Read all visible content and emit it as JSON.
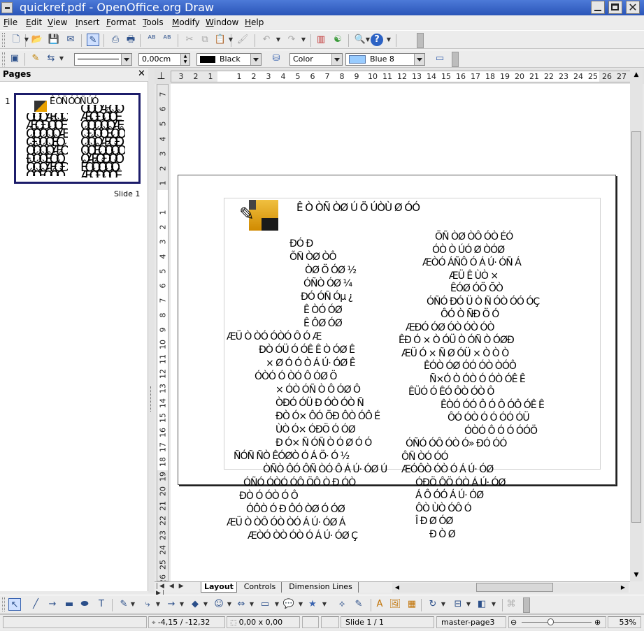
{
  "window": {
    "title": "quickref.pdf - OpenOffice.org Draw"
  },
  "menu": [
    {
      "label": "File",
      "mnemonic": "F",
      "rest": "ile"
    },
    {
      "label": "Edit",
      "mnemonic": "E",
      "rest": "dit"
    },
    {
      "label": "View",
      "mnemonic": "V",
      "rest": "iew"
    },
    {
      "label": "Insert",
      "mnemonic": "I",
      "rest": "nsert"
    },
    {
      "label": "Format",
      "mnemonic": "F",
      "rest": "ormat"
    },
    {
      "label": "Tools",
      "mnemonic": "T",
      "rest": "ools"
    },
    {
      "label": "Modify",
      "mnemonic": "M",
      "rest": "odify"
    },
    {
      "label": "Window",
      "mnemonic": "W",
      "rest": "indow"
    },
    {
      "label": "Help",
      "mnemonic": "H",
      "rest": "elp"
    }
  ],
  "line_toolbar": {
    "line_width": "0,00cm",
    "line_color": "Black",
    "area_style": "Color",
    "area_color": "Blue 8",
    "line_color_hex": "#000000",
    "area_color_hex": "#99ccff"
  },
  "pages_pane": {
    "title": "Pages",
    "slide_number": "1",
    "slide_label": "Slide 1"
  },
  "rulers": {
    "h": [
      "3",
      "2",
      "1",
      "1",
      "2",
      "3",
      "4",
      "5",
      "6",
      "7",
      "8",
      "9",
      "10",
      "11",
      "12",
      "13",
      "14",
      "15",
      "16",
      "17",
      "18",
      "19",
      "20",
      "21",
      "22",
      "23",
      "24",
      "25",
      "26",
      "27"
    ],
    "v": [
      "7",
      "6",
      "5",
      "4",
      "3",
      "2",
      "1",
      "1",
      "2",
      "3",
      "4",
      "5",
      "6",
      "7",
      "8",
      "9",
      "10",
      "11",
      "12",
      "13",
      "14",
      "15",
      "16",
      "17",
      "18",
      "19",
      "20",
      "21",
      "22",
      "23",
      "24",
      "25",
      "26"
    ]
  },
  "page_text": {
    "header": "Ê        Ò   ÒÑ   ÒØ Ú Ö           ÚÒÙ Ø ÓÓ",
    "left": [
      "ÐÓ Ð",
      "ÕÑ ÒØ ÒÔ",
      "ÒØ Ö      ÓØ ½",
      "ÓÑÒ      ÓØ ¼",
      "ÐÓ ÓÑ      Óµ ¿",
      "Ê ÒÓ      ÓØ",
      "Ê ÔØ      ÓØ",
      "ÆÜ Ò ÒÓ ÓÒÓ Ô      Ó Æ",
      "ÐÒ ÓÜ  Ó ÓÊ Ê Ò      ÓØ Ê",
      "× Ø Ó  Ó Ò Á Ú·      ÓØ Ê",
      "ÓÒÓ Ó ÒÓ Ô      ÓØ Ö",
      "× ÓÒ ÓÑ Ò Ô      ÓØ Ô",
      "ÒÐÓ ÓÜ Ð ÓÒ      ÓÒ Ñ",
      "ÐÒ Ó× ÔÓ  ÖÐ ÔÒ      ÓÔ É",
      "ÙÒ Ó× ÓÐÖ Ó       ÓØ",
      "Ð Ó× Ñ ÓÑ Ò Ó Ø   Ó Ó",
      "ÑÓÑ ÑÒ ÊÓØÒ   Ó Á Ö·   Ó ½",
      "ÒÑÒ ÔÓ ÔÑ ÒÓ Ô  Á Ú·   ÓØ Ú",
      "ÓÑÓ  ÓÒÓ      ÓÔ ÖÔ      Ò Ð ÓÒ",
      "ÐÒ Ó   ÓÒ  Ó Ô",
      "ÓÔÒ Ó Ð ÔÓ  ÒØ   Ó ÓØ",
      "ÆÜ Ò ÒÔ ÓÒ ÒÓ   Á Ú·   ÓØ Á",
      "ÆÒÓ ÒÒ ÓÒ Ó  Á Ú·   ÓØ Ç"
    ],
    "right": [
      "ÕÑ ÒØ ÒÔ ÓÒ ÉÓ",
      "ÓÒ Ò ÚÓ Ø ÒÓØ",
      "ÆÒÓ ÁÑÔ   Ó Á Ú·   ÓÑ Á",
      "ÆÜ Ê ÙÒ ×",
      "ÊÓØ ÓÖ ÕÒ",
      "ÓÑÓ ÐÓ Ü Ò Ñ ÓÒ  ÓÓ ÓÇ",
      "ÔÓ Ò ÑÐ Ö  Ó",
      "ÆÐÓ ÓØ ÓÒ  ÓÒ  ÓÒ",
      "ÊÐ Ó × Ò ÓÜ Ò ÓÑ Ò   ÓØÐ",
      "ÆÜ Ó  × Ñ Ø ÓÜ × Ò  Ò Ò",
      "ÊÓÒ ÓØ ÓÓ ÓÒ  ÒÓÔ",
      "Ñ×Ó Ò ÓÒ Ó ÓÒ  ÓÊ Ê",
      "ÊÜÓ Ó  ÊÓ ÔÒ  ÓÒ Ô",
      "ÊÒÓ ÓÓ Ô Ó Ô ÓÔ   ÓÊ Ê",
      "ÔÓ ÓÒ Ó  Ó ÓÓ ÓÜ",
      "ÓÒÓ Ô Ó Ó ÓÓÖ",
      "ÓÑÓ ÓÔ  ÓÒ Ó»   ÐÓ  ÓÓ",
      "ÔÑ ÒÓ  ÓÓ",
      "ÆÓÔÒ ÓÒ Ó  Á Ú·   ÓØ",
      "ÓÐÖ ÔÖ ÓÒ  Á Ú·   ÓØ",
      "Á Ô ÓÓ  Á Ú·   ÓØ",
      "ÔÒ ÙÒ ÓÔ Ó",
      "Î   Ð Ø   ÓØ",
      "Ð Ò Ø"
    ]
  },
  "sheet_tabs": [
    "Layout",
    "Controls",
    "Dimension Lines"
  ],
  "status": {
    "position": "-4,15 / -12,32",
    "size": "0,00 x 0,00",
    "slide": "Slide 1 / 1",
    "master": "master-page3",
    "zoom": "53%",
    "zoom_level": 0.53
  },
  "toolbar_icons": {
    "standard": [
      "new-document-icon",
      "open-folder-icon",
      "save-icon",
      "email-icon",
      "edit-file-icon",
      "export-pdf-icon",
      "print-icon",
      "spellcheck-icon",
      "autospellcheck-icon",
      "cut-icon",
      "copy-icon",
      "paste-icon",
      "clone-format-icon",
      "undo-icon",
      "redo-icon",
      "chart-icon",
      "navigator-icon",
      "zoom-icon",
      "help-icon"
    ],
    "drawing": [
      "select-icon",
      "line-icon",
      "arrow-line-icon",
      "rectangle-icon",
      "ellipse-icon",
      "text-icon",
      "curve-icon",
      "connector-icon",
      "lines-arrows-icon",
      "basic-shapes-icon",
      "symbol-shapes-icon",
      "block-arrows-icon",
      "flowchart-icon",
      "callouts-icon",
      "stars-icon",
      "points-icon",
      "glue-points-icon",
      "fontwork-icon",
      "from-file-icon",
      "gallery-icon",
      "rotate-icon",
      "alignment-icon",
      "arrange-icon",
      "extrusion-icon"
    ]
  }
}
